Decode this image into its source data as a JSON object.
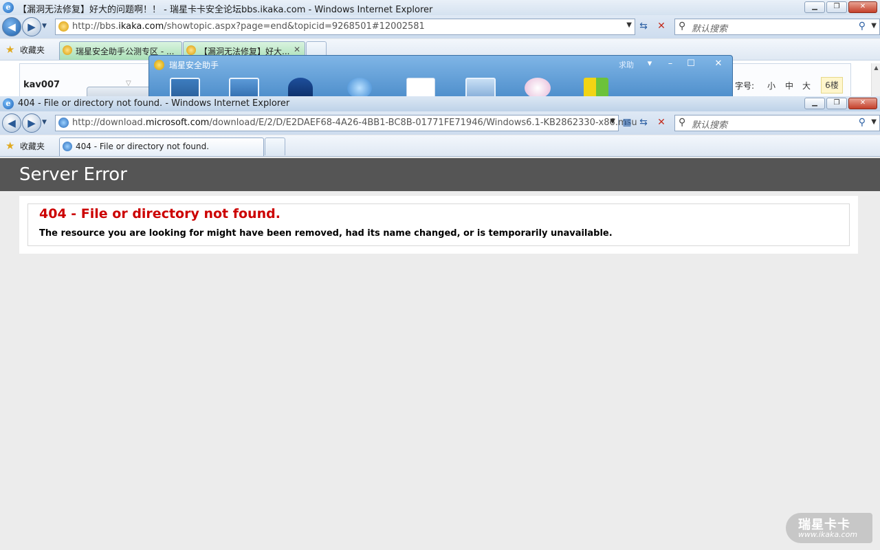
{
  "back_window": {
    "title": "【漏洞无法修复】好大的问题啊！！ - 瑞星卡卡安全论坛bbs.ikaka.com - Windows Internet Explorer",
    "address": {
      "prefix": "http://bbs.",
      "host": "ikaka.com",
      "path": "/showtopic.aspx?page=end&topicid=9268501#12002581"
    },
    "search_placeholder": "默认搜索",
    "favorites_label": "收藏夹",
    "tabs": [
      {
        "label": "瑞星安全助手公测专区 - ..."
      },
      {
        "label": "【漏洞无法修复】好大..."
      }
    ],
    "page": {
      "username": "kav007",
      "font_size_label": "字号:",
      "font_sizes": [
        "小",
        "中",
        "大"
      ],
      "floor": "6楼"
    }
  },
  "popup": {
    "title": "瑞星安全助手",
    "help_label": "求助"
  },
  "front_window": {
    "title": "404 - File or directory not found. - Windows Internet Explorer",
    "address": {
      "prefix": "http://download.",
      "host": "microsoft.com",
      "path": "/download/E/2/D/E2DAEF68-4A26-4BB1-BC8B-01771FE71946/Windows6.1-KB2862330-x86.msu"
    },
    "search_placeholder": "默认搜索",
    "favorites_label": "收藏夹",
    "tabs": [
      {
        "label": "404 - File or directory not found."
      }
    ]
  },
  "error_page": {
    "header": "Server Error",
    "heading": "404 - File or directory not found.",
    "message": "The resource you are looking for might have been removed, had its name changed, or is temporarily unavailable."
  },
  "watermark": {
    "name": "瑞星卡卡",
    "url": "www.ikaka.com"
  },
  "colors": {
    "error_red": "#cc0000",
    "header_gray": "#555555",
    "content_bg": "#ececec"
  }
}
